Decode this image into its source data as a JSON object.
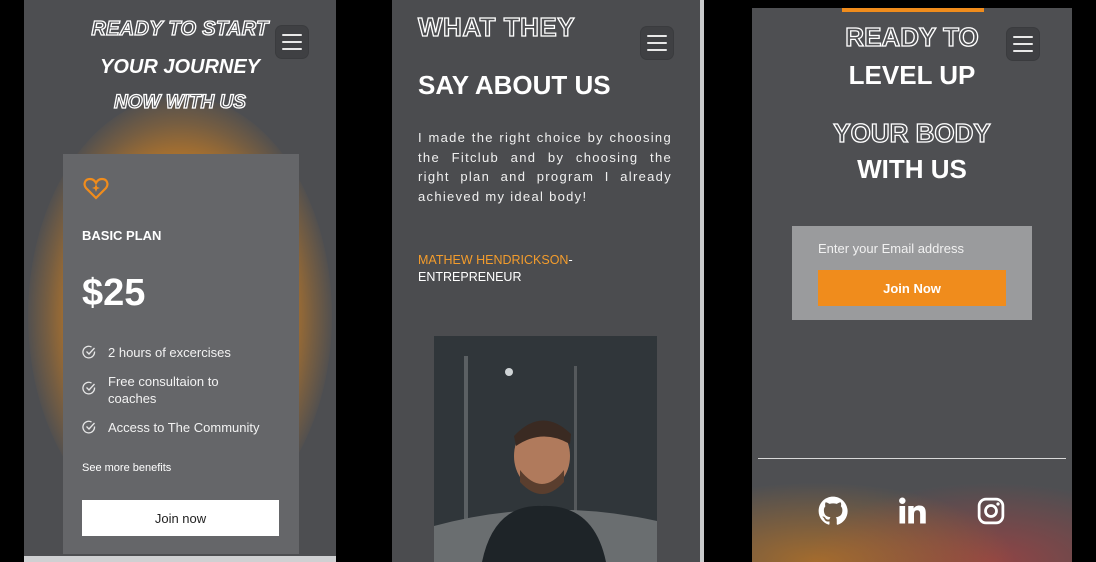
{
  "panel1": {
    "heading_line1": "READY TO START",
    "heading_line2": "YOUR JOURNEY",
    "heading_line3": "NOW WITH US",
    "plan": {
      "icon": "heart-icon",
      "name": "BASIC PLAN",
      "price": "$25",
      "features": [
        "2 hours of excercises",
        "Free consultaion to coaches",
        "Access to The Community"
      ],
      "see_more": "See more benefits",
      "button_label": "Join now"
    }
  },
  "panel2": {
    "heading_outline": "WHAT THEY",
    "heading": "SAY ABOUT US",
    "quote": "I made the right choice by choosing the Fitclub and by choosing the right plan and program I already achieved my ideal body!",
    "author_name": "MATHEW HENDRICKSON",
    "author_separator": "-",
    "author_role": "ENTREPRENEUR"
  },
  "panel3": {
    "line1": "READY TO",
    "line2": "LEVEL UP",
    "line3": "YOUR BODY",
    "line4": "WITH US",
    "email_placeholder": "Enter your Email address",
    "button_label": "Join Now",
    "social_icons": [
      "github-icon",
      "linkedin-icon",
      "instagram-icon"
    ]
  },
  "colors": {
    "accent": "#f08c1c",
    "panel_bg": "#4d4e51",
    "card_bg": "#656669"
  }
}
